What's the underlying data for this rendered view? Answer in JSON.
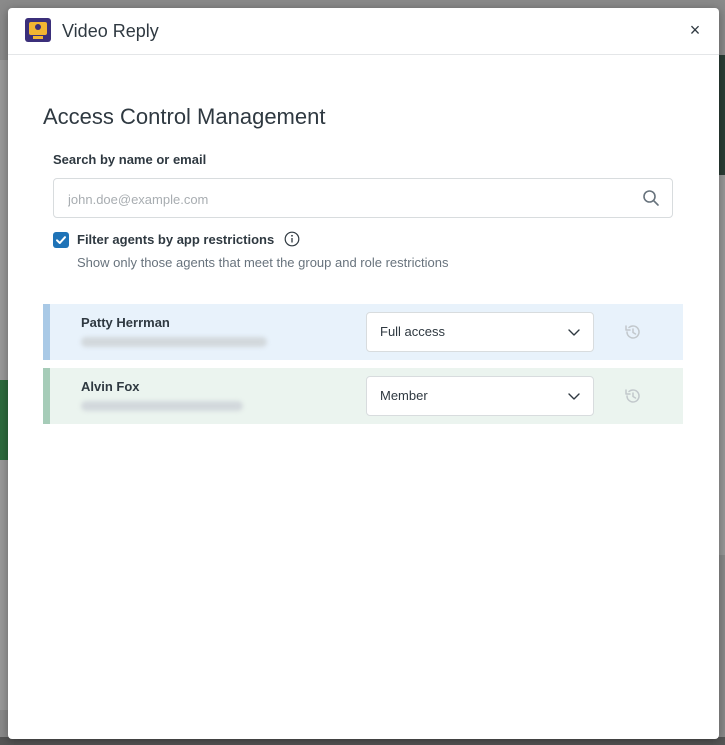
{
  "modal": {
    "title": "Video Reply",
    "close_symbol": "×",
    "heading": "Access Control Management"
  },
  "search": {
    "label": "Search by name or email",
    "placeholder": "john.doe@example.com",
    "value": ""
  },
  "filter": {
    "checked": true,
    "label": "Filter agents by app restrictions",
    "hint": "Show only those agents that meet the group and role restrictions"
  },
  "agents": [
    {
      "name": "Patty Herrman",
      "role": "Full access"
    },
    {
      "name": "Alvin Fox",
      "role": "Member"
    }
  ],
  "colors": {
    "accent_blue": "#1f73b7",
    "row_blue": "#e8f2fb",
    "row_green": "#ebf4ef",
    "logo_purple": "#3b2f7a",
    "logo_yellow": "#f2b531"
  },
  "icons": [
    "app-logo-icon",
    "close-icon",
    "search-icon",
    "checkbox-checked-icon",
    "info-icon",
    "chevron-down-icon",
    "history-icon"
  ]
}
